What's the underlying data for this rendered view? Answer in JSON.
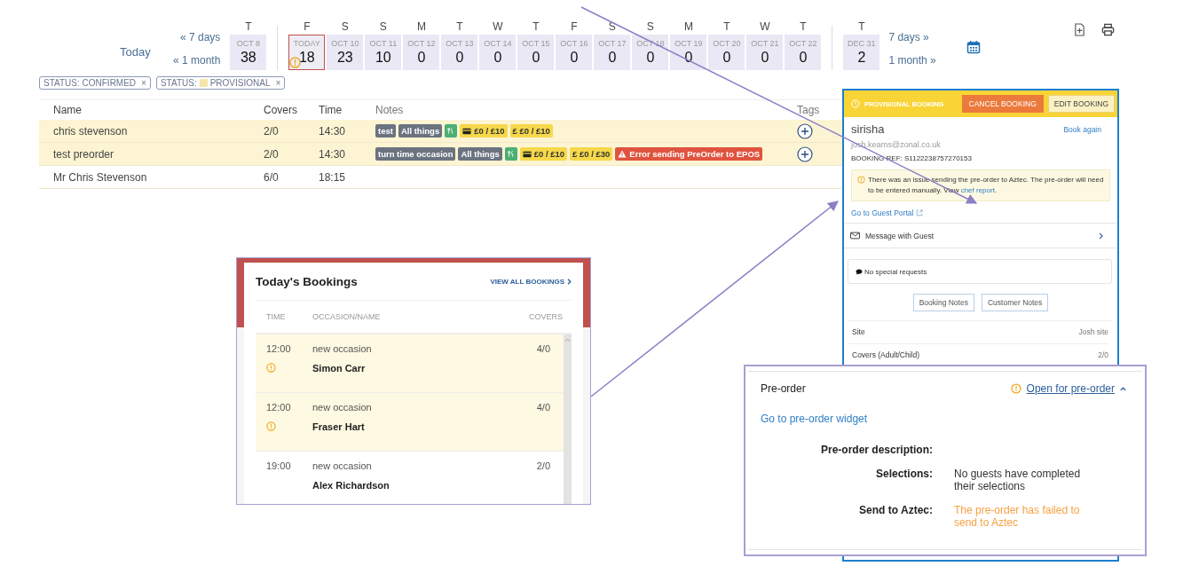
{
  "calendar": {
    "today_label": "Today",
    "back_links": [
      "« 7 days",
      "« 1 month"
    ],
    "forward_links": [
      "7 days »",
      "1 month »"
    ],
    "groups": [
      [
        {
          "weekday": "T",
          "date": "OCT 8",
          "count": "38",
          "selected": false,
          "warning": false
        }
      ],
      [
        {
          "weekday": "F",
          "date": "TODAY",
          "count": "18",
          "selected": true,
          "warning": true
        },
        {
          "weekday": "S",
          "date": "OCT 10",
          "count": "23",
          "selected": false,
          "warning": false
        },
        {
          "weekday": "S",
          "date": "OCT 11",
          "count": "10",
          "selected": false,
          "warning": false
        },
        {
          "weekday": "M",
          "date": "OCT 12",
          "count": "0",
          "selected": false,
          "warning": false
        },
        {
          "weekday": "T",
          "date": "OCT 13",
          "count": "0",
          "selected": false,
          "warning": false
        },
        {
          "weekday": "W",
          "date": "OCT 14",
          "count": "0",
          "selected": false,
          "warning": false
        },
        {
          "weekday": "T",
          "date": "OCT 15",
          "count": "0",
          "selected": false,
          "warning": false
        },
        {
          "weekday": "F",
          "date": "OCT 16",
          "count": "0",
          "selected": false,
          "warning": false
        },
        {
          "weekday": "S",
          "date": "OCT 17",
          "count": "0",
          "selected": false,
          "warning": false
        },
        {
          "weekday": "S",
          "date": "OCT 18",
          "count": "0",
          "selected": false,
          "warning": false
        },
        {
          "weekday": "M",
          "date": "OCT 19",
          "count": "0",
          "selected": false,
          "warning": false
        },
        {
          "weekday": "T",
          "date": "OCT 20",
          "count": "0",
          "selected": false,
          "warning": false
        },
        {
          "weekday": "W",
          "date": "OCT 21",
          "count": "0",
          "selected": false,
          "warning": false
        },
        {
          "weekday": "T",
          "date": "OCT 22",
          "count": "0",
          "selected": false,
          "warning": false
        }
      ],
      [
        {
          "weekday": "T",
          "date": "DEC 31",
          "count": "2",
          "selected": false,
          "warning": false
        }
      ]
    ]
  },
  "filters": [
    {
      "prefix": "STATUS: CONFIRMED",
      "close": "×"
    },
    {
      "prefix": "STATUS:",
      "value": "PROVISIONAL",
      "color": "#f5e6a8",
      "close": "×"
    }
  ],
  "table": {
    "columns": [
      "Name",
      "Covers",
      "Time",
      "Notes",
      "Tags"
    ],
    "rows": [
      {
        "name": "chris stevenson",
        "covers": "2/0",
        "time": "14:30",
        "provisional": true,
        "add_tag": true,
        "notes": [
          {
            "kind": "label",
            "text": "test"
          },
          {
            "kind": "label",
            "text": "All things"
          },
          {
            "kind": "cutlery"
          },
          {
            "kind": "card",
            "text": "£0 / £10"
          },
          {
            "kind": "money",
            "text": "£ £0 / £10"
          }
        ]
      },
      {
        "name": "test preorder",
        "covers": "2/0",
        "time": "14:30",
        "provisional": true,
        "add_tag": true,
        "notes": [
          {
            "kind": "label",
            "text": "turn time occasion"
          },
          {
            "kind": "label",
            "text": "All things"
          },
          {
            "kind": "cutlery"
          },
          {
            "kind": "card",
            "text": "£0 / £10"
          },
          {
            "kind": "money",
            "text": "£ £0 / £30"
          },
          {
            "kind": "error",
            "text": "Error sending PreOrder to EPOS"
          }
        ]
      },
      {
        "name": "Mr Chris Stevenson",
        "covers": "6/0",
        "time": "18:15",
        "provisional": false,
        "add_tag": false,
        "notes": []
      }
    ]
  },
  "todays_bookings": {
    "title": "Today's Bookings",
    "link": "VIEW ALL BOOKINGS",
    "columns": [
      "TIME",
      "OCCASION/NAME",
      "COVERS"
    ],
    "rows": [
      {
        "time": "12:00",
        "occasion": "new occasion",
        "name": "Simon Carr",
        "covers": "4/0",
        "provisional": true,
        "warning": true
      },
      {
        "time": "12:00",
        "occasion": "new occasion",
        "name": "Fraser Hart",
        "covers": "4/0",
        "provisional": true,
        "warning": true
      },
      {
        "time": "19:00",
        "occasion": "new occasion",
        "name": "Alex Richardson",
        "covers": "2/0",
        "provisional": false,
        "warning": false
      }
    ]
  },
  "booking": {
    "status": "PROVISIONAL BOOKING",
    "cancel": "CANCEL BOOKING",
    "edit": "EDIT BOOKING",
    "name": "sirisha",
    "book_again": "Book again",
    "email": "josh.kearns@zonal.co.uk",
    "ref": "BOOKING REF: S1122238757270153",
    "alert": "There was an issue sending the pre-order to Aztec. The pre-order will need to be entered manually. View",
    "alert_link": "chef report",
    "alert_end": ".",
    "portal": "Go to Guest Portal",
    "message": "Message with Guest",
    "requests": "No special requests",
    "note_buttons": [
      "Booking Notes",
      "Customer Notes"
    ],
    "details": [
      {
        "label": "Site",
        "value": "Josh site"
      },
      {
        "label": "Covers (Adult/Child)",
        "value": "2/0"
      }
    ]
  },
  "preorder": {
    "title": "Pre-order",
    "status": "Open for pre-order",
    "expanded": true,
    "widget_link": "Go to pre-order widget",
    "fields": [
      {
        "label": "Pre-order description:"
      },
      {
        "label": "Selections:",
        "value": "No guests have completed their selections",
        "kind": "normal"
      },
      {
        "label": "Send to Aztec:",
        "value": "The pre-order has failed to send to Aztec",
        "kind": "error"
      }
    ]
  }
}
